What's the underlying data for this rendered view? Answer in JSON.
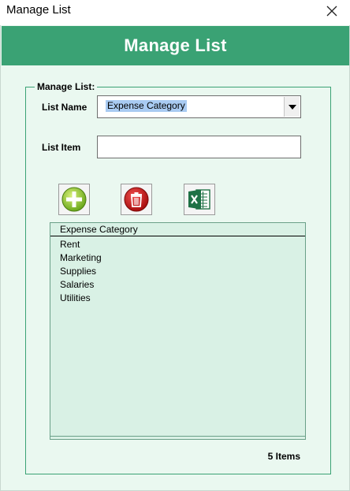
{
  "window": {
    "title": "Manage List"
  },
  "banner": {
    "title": "Manage List"
  },
  "group": {
    "legend": "Manage List:"
  },
  "form": {
    "list_name_label": "List Name",
    "list_name_value": "Expense Category",
    "list_item_label": "List Item",
    "list_item_value": ""
  },
  "toolbar": {
    "add_icon": "add-icon",
    "delete_icon": "delete-icon",
    "excel_icon": "excel-icon"
  },
  "list": {
    "header": "Expense Category",
    "items": [
      "Rent",
      "Marketing",
      "Supplies",
      "Salaries",
      "Utilities"
    ]
  },
  "status": {
    "count_text": "5 Items"
  },
  "colors": {
    "accent": "#3aa274",
    "panel_bg": "#eaf8f0",
    "list_bg": "#d9f1e5"
  }
}
